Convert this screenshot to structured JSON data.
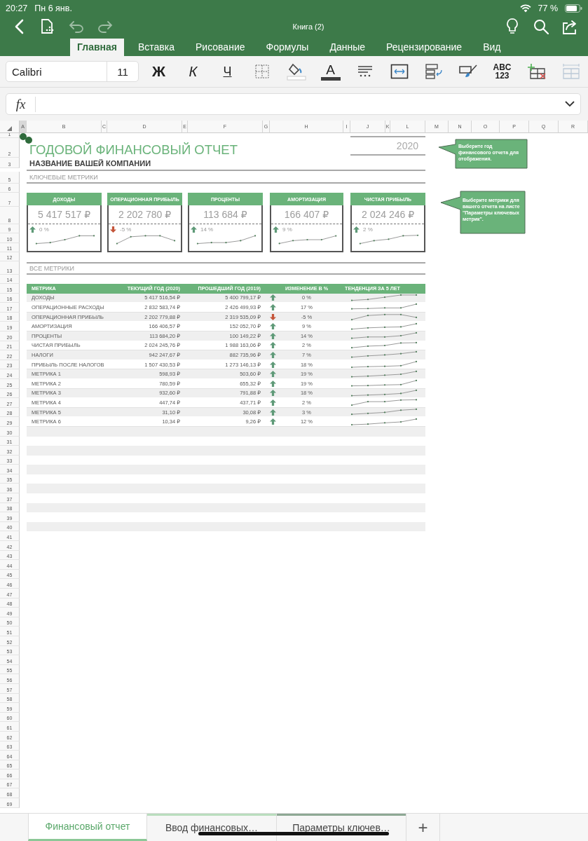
{
  "status_bar": {
    "time": "20:27",
    "date": "Пн 6 янв.",
    "battery": "77 %"
  },
  "title_bar": {
    "title": "Книга (2)",
    "left_buttons": [
      {
        "kind": "back",
        "disabled": false
      },
      {
        "kind": "file",
        "disabled": false
      },
      {
        "kind": "undo",
        "disabled": true
      },
      {
        "kind": "redo",
        "disabled": true
      }
    ],
    "right_buttons": [
      {
        "kind": "ideas"
      },
      {
        "kind": "search"
      },
      {
        "kind": "share"
      }
    ]
  },
  "ribbon_tabs": [
    {
      "label": "Главная",
      "selected": true
    },
    {
      "label": "Вставка",
      "selected": false
    },
    {
      "label": "Рисование",
      "selected": false
    },
    {
      "label": "Формулы",
      "selected": false
    },
    {
      "label": "Данные",
      "selected": false
    },
    {
      "label": "Рецензирование",
      "selected": false
    },
    {
      "label": "Вид",
      "selected": false
    }
  ],
  "ribbon": {
    "font": "Calibri",
    "size": "11",
    "buttons": [
      {
        "kind": "bold",
        "label": "Ж"
      },
      {
        "kind": "italic",
        "label": "К"
      },
      {
        "kind": "underline",
        "label": "Ч"
      },
      {
        "kind": "borders"
      },
      {
        "kind": "fill"
      },
      {
        "kind": "font_color",
        "label": "A"
      },
      {
        "kind": "align"
      },
      {
        "kind": "merge"
      },
      {
        "kind": "wrap"
      },
      {
        "kind": "format_painter"
      },
      {
        "kind": "number_format",
        "label": "ABC 123"
      },
      {
        "kind": "insert"
      },
      {
        "kind": "faded"
      }
    ]
  },
  "formula_bar": {
    "label": "fx"
  },
  "column_headers": [
    {
      "label": "A",
      "selected": true
    },
    {
      "label": "B",
      "selected": false
    },
    {
      "label": "C",
      "selected": false
    },
    {
      "label": "D",
      "selected": false
    },
    {
      "label": "E",
      "selected": false
    },
    {
      "label": "F",
      "selected": false
    },
    {
      "label": "G",
      "selected": false
    },
    {
      "label": "H",
      "selected": false
    },
    {
      "label": "I",
      "selected": false
    },
    {
      "label": "J",
      "selected": false
    },
    {
      "label": "K",
      "selected": false
    },
    {
      "label": "L",
      "selected": false
    },
    {
      "label": "M",
      "selected": false
    },
    {
      "label": "N",
      "selected": false
    },
    {
      "label": "O",
      "selected": false
    },
    {
      "label": "P",
      "selected": false
    },
    {
      "label": "Q",
      "selected": false
    },
    {
      "label": "R",
      "selected": false
    }
  ],
  "row_numbers": [
    "1",
    "2",
    "3",
    "5",
    "6",
    "7",
    "8",
    "9",
    "10",
    "11",
    "12",
    "13",
    "14",
    "15",
    "16",
    "17",
    "18",
    "19",
    "20",
    "21",
    "22",
    "23",
    "24",
    "25",
    "26",
    "27",
    "28",
    "29",
    "30",
    "31",
    "32",
    "33",
    "34",
    "35",
    "36",
    "37",
    "38",
    "39",
    "40",
    "41",
    "42",
    "43",
    "44",
    "45",
    "46",
    "47",
    "48",
    "49",
    "50",
    "51",
    "52",
    "53",
    "54",
    "55",
    "56",
    "57",
    "58",
    "59",
    "60",
    "61",
    "62",
    "63",
    "64",
    "65",
    "66",
    "67",
    "68",
    "69"
  ],
  "report": {
    "title": "ГОДОВОЙ ФИНАНСОВЫЙ ОТЧЕТ",
    "year": "2020",
    "company": "НАЗВАНИЕ ВАШЕЙ КОМПАНИИ",
    "key_metrics_heading": "КЛЮЧЕВЫЕ МЕТРИКИ",
    "all_metrics_heading": "ВСЕ МЕТРИКИ"
  },
  "callouts": [
    "Выберите год финансового отчета для отображения.",
    "Выберите метрики для вашего отчета на листе \"Параметры ключевых метрик\"."
  ],
  "cards": [
    {
      "title": "ДОХОДЫ",
      "value": "5 417 517 ₽",
      "change": "0 %",
      "kind": "up"
    },
    {
      "title": "ОПЕРАЦИОННАЯ ПРИБЫЛЬ",
      "value": "2 202 780 ₽",
      "change": "-5 %",
      "kind": "down"
    },
    {
      "title": "ПРОЦЕНТЫ",
      "value": "113 684 ₽",
      "change": "14 %",
      "kind": "up"
    },
    {
      "title": "АМОРТИЗАЦИЯ",
      "value": "166 407 ₽",
      "change": "9 %",
      "kind": "up"
    },
    {
      "title": "ЧИСТАЯ ПРИБЫЛЬ",
      "value": "2 024 246 ₽",
      "change": "2 %",
      "kind": "up"
    }
  ],
  "table": {
    "columns": [
      "МЕТРИКА",
      "ТЕКУЩИЙ ГОД (2020)",
      "ПРОШЕДШИЙ ГОД (2019)",
      "ИЗМЕНЕНИЕ В %",
      "ТЕНДЕНЦИЯ ЗА 5 ЛЕТ"
    ],
    "rows": [
      {
        "metric": "ДОХОДЫ",
        "current": "5 417 516,54 ₽",
        "previous": "5 400 799,17 ₽",
        "kind": "up",
        "change": "0 %"
      },
      {
        "metric": "ОПЕРАЦИОННЫЕ РАСХОДЫ",
        "current": "2 832 583,74 ₽",
        "previous": "2 426 499,93 ₽",
        "kind": "up",
        "change": "17 %"
      },
      {
        "metric": "ОПЕРАЦИОННАЯ ПРИБЫЛЬ",
        "current": "2 202 779,88 ₽",
        "previous": "2 319 535,09 ₽",
        "kind": "down",
        "change": "-5 %"
      },
      {
        "metric": "АМОРТИЗАЦИЯ",
        "current": "166 406,57 ₽",
        "previous": "152 052,70 ₽",
        "kind": "up",
        "change": "9 %"
      },
      {
        "metric": "ПРОЦЕНТЫ",
        "current": "113 684,20 ₽",
        "previous": "100 149,22 ₽",
        "kind": "up",
        "change": "14 %"
      },
      {
        "metric": "ЧИСТАЯ ПРИБЫЛЬ",
        "current": "2 024 245,76 ₽",
        "previous": "1 988 163,06 ₽",
        "kind": "up",
        "change": "2 %"
      },
      {
        "metric": "НАЛОГИ",
        "current": "942 247,67 ₽",
        "previous": "882 735,96 ₽",
        "kind": "up",
        "change": "7 %"
      },
      {
        "metric": "ПРИБЫЛЬ ПОСЛЕ НАЛОГОВ",
        "current": "1 507 430,53 ₽",
        "previous": "1 273 146,13 ₽",
        "kind": "up",
        "change": "18 %"
      },
      {
        "metric": "МЕТРИКА 1",
        "current": "598,93 ₽",
        "previous": "503,60 ₽",
        "kind": "up",
        "change": "19 %"
      },
      {
        "metric": "МЕТРИКА 2",
        "current": "780,59 ₽",
        "previous": "655,32 ₽",
        "kind": "up",
        "change": "19 %"
      },
      {
        "metric": "МЕТРИКА 3",
        "current": "932,60 ₽",
        "previous": "791,88 ₽",
        "kind": "up",
        "change": "18 %"
      },
      {
        "metric": "МЕТРИКА 4",
        "current": "447,74 ₽",
        "previous": "437,71 ₽",
        "kind": "up",
        "change": "2 %"
      },
      {
        "metric": "МЕТРИКА 5",
        "current": "31,10 ₽",
        "previous": "30,08 ₽",
        "kind": "up",
        "change": "3 %"
      },
      {
        "metric": "МЕТРИКА 6",
        "current": "10,34 ₽",
        "previous": "9,26 ₽",
        "kind": "up",
        "change": "12 %"
      }
    ]
  },
  "sheet_tabs": [
    {
      "label": "Финансовый отчет",
      "selected": true
    },
    {
      "label": "Ввод финансовых…",
      "selected": false,
      "color": "#b9ddbd"
    },
    {
      "label": "Параметры ключев…",
      "selected": false,
      "color": "#8da894"
    }
  ],
  "add_sheet": "+"
}
